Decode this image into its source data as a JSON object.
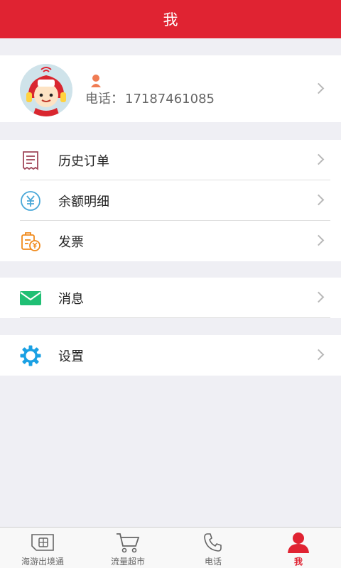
{
  "header": {
    "title": "我"
  },
  "profile": {
    "phone_label": "电话：",
    "phone_number": "17187461085"
  },
  "menu_group1": [
    {
      "label": "历史订单",
      "icon": "receipt-icon"
    },
    {
      "label": "余额明细",
      "icon": "yuan-circle-icon"
    },
    {
      "label": "发票",
      "icon": "invoice-icon"
    }
  ],
  "menu_group2": [
    {
      "label": "消息",
      "icon": "envelope-icon"
    }
  ],
  "menu_group3": [
    {
      "label": "设置",
      "icon": "gear-icon"
    }
  ],
  "tabbar": [
    {
      "label": "海游出境通",
      "icon": "sim-card-icon"
    },
    {
      "label": "流量超市",
      "icon": "cart-icon"
    },
    {
      "label": "电话",
      "icon": "phone-icon"
    },
    {
      "label": "我",
      "icon": "person-icon",
      "active": true
    }
  ],
  "colors": {
    "brand": "#e02332",
    "background": "#efeff4",
    "message_green": "#1fbf74",
    "settings_blue": "#1aa0e3",
    "invoice_orange": "#f08a1c"
  }
}
